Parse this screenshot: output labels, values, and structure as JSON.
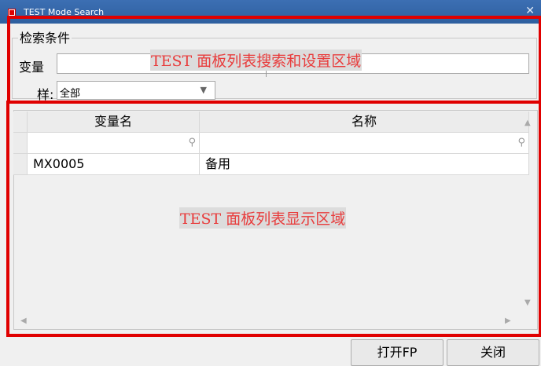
{
  "window": {
    "title": "TEST Mode Search"
  },
  "search": {
    "group_label": "检索条件",
    "variable_label": "变量",
    "variable_value": "",
    "style_label": "样:",
    "style_selected": "全部"
  },
  "table": {
    "columns": [
      "变量名",
      "名称"
    ],
    "rows": [
      {
        "var_name": "MX0005",
        "name": "备用"
      }
    ]
  },
  "annotations": {
    "top": "TEST 面板列表搜索和设置区域",
    "bottom": "TEST 面板列表显示区域",
    "color": "#e00000"
  },
  "buttons": {
    "open": "打开FP",
    "close": "关闭"
  }
}
